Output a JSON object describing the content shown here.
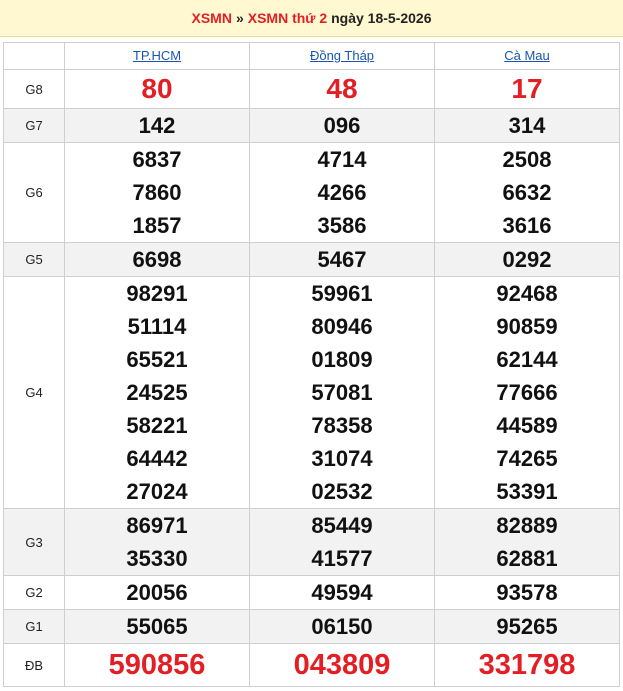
{
  "breadcrumb": {
    "link1": "XSMN",
    "separator": "»",
    "link2": "XSMN thứ 2",
    "date_text": "ngày 18-5-2026"
  },
  "provinces": [
    "TP.HCM",
    "Đồng Tháp",
    "Cà Mau"
  ],
  "prizes": [
    {
      "label": "G8",
      "results": [
        [
          "80"
        ],
        [
          "48"
        ],
        [
          "17"
        ]
      ]
    },
    {
      "label": "G7",
      "results": [
        [
          "142"
        ],
        [
          "096"
        ],
        [
          "314"
        ]
      ]
    },
    {
      "label": "G6",
      "results": [
        [
          "6837",
          "7860",
          "1857"
        ],
        [
          "4714",
          "4266",
          "3586"
        ],
        [
          "2508",
          "6632",
          "3616"
        ]
      ]
    },
    {
      "label": "G5",
      "results": [
        [
          "6698"
        ],
        [
          "5467"
        ],
        [
          "0292"
        ]
      ]
    },
    {
      "label": "G4",
      "results": [
        [
          "98291",
          "51114",
          "65521",
          "24525",
          "58221",
          "64442",
          "27024"
        ],
        [
          "59961",
          "80946",
          "01809",
          "57081",
          "78358",
          "31074",
          "02532"
        ],
        [
          "92468",
          "90859",
          "62144",
          "77666",
          "44589",
          "74265",
          "53391"
        ]
      ]
    },
    {
      "label": "G3",
      "results": [
        [
          "86971",
          "35330"
        ],
        [
          "85449",
          "41577"
        ],
        [
          "82889",
          "62881"
        ]
      ]
    },
    {
      "label": "G2",
      "results": [
        [
          "20056"
        ],
        [
          "49594"
        ],
        [
          "93578"
        ]
      ]
    },
    {
      "label": "G1",
      "results": [
        [
          "55065"
        ],
        [
          "06150"
        ],
        [
          "95265"
        ]
      ]
    },
    {
      "label": "ĐB",
      "results": [
        [
          "590856"
        ],
        [
          "043809"
        ],
        [
          "331798"
        ]
      ]
    }
  ],
  "colors": {
    "accent_red": "#e31e24",
    "link_blue": "#1a56b0",
    "header_bg": "#fff8d1",
    "row_alt_bg": "#f2f2f2"
  }
}
